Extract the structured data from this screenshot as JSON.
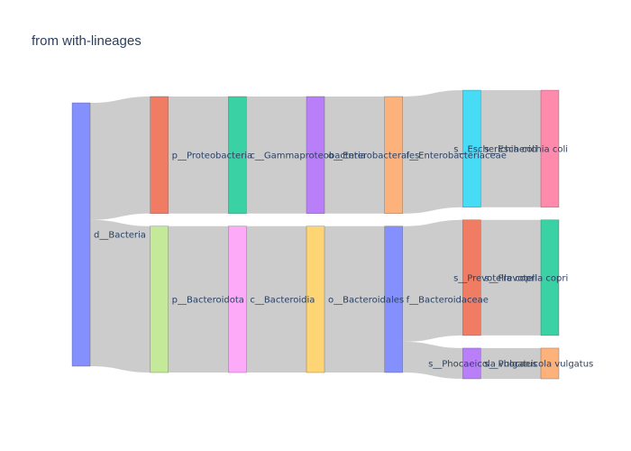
{
  "chart_data": {
    "type": "sankey",
    "title": "from with-lineages",
    "nodes": [
      {
        "id": "d",
        "label": "d__Bacteria",
        "column": 0,
        "color": "#8590ff"
      },
      {
        "id": "p_prot",
        "label": "p__Proteobacteria",
        "column": 1,
        "color": "#f07c63"
      },
      {
        "id": "p_bact",
        "label": "p__Bacteroidota",
        "column": 1,
        "color": "#c4ea99"
      },
      {
        "id": "c_gamma",
        "label": "c__Gammaproteobacteria",
        "column": 2,
        "color": "#3ad1a4"
      },
      {
        "id": "c_bact",
        "label": "c__Bacteroidia",
        "column": 2,
        "color": "#fdaaf8"
      },
      {
        "id": "o_entero",
        "label": "o__Enterobacterales",
        "column": 3,
        "color": "#b97ff9"
      },
      {
        "id": "o_bact",
        "label": "o__Bacteroidales",
        "column": 3,
        "color": "#fed574"
      },
      {
        "id": "f_entero",
        "label": "f__Enterobacteriaceae",
        "column": 4,
        "color": "#fdb27c"
      },
      {
        "id": "f_bact",
        "label": "f__Bacteroidaceae",
        "column": 4,
        "color": "#8590ff"
      },
      {
        "id": "s_ecoli",
        "label": "s__Escherichia coli",
        "column": 5,
        "color": "#48dbf5"
      },
      {
        "id": "s_prev",
        "label": "s__Prevotella copri",
        "column": 5,
        "color": "#f07c63"
      },
      {
        "id": "s_phoc",
        "label": "s__Phocaeicola vulgatus",
        "column": 5,
        "color": "#b97ff9"
      },
      {
        "id": "t_ecoli",
        "label": "s__Escherichia coli",
        "column": 6,
        "color": "#fe8aac"
      },
      {
        "id": "t_prev",
        "label": "s__Prevotella copri",
        "column": 6,
        "color": "#3ad1a4"
      },
      {
        "id": "t_phoc",
        "label": "s__Phocaeicola vulgatus",
        "column": 6,
        "color": "#fdb27c"
      }
    ],
    "links": [
      {
        "source": "d",
        "target": "p_prot",
        "value": 40
      },
      {
        "source": "d",
        "target": "p_bact",
        "value": 50
      },
      {
        "source": "p_prot",
        "target": "c_gamma",
        "value": 40
      },
      {
        "source": "p_bact",
        "target": "c_bact",
        "value": 50
      },
      {
        "source": "c_gamma",
        "target": "o_entero",
        "value": 40
      },
      {
        "source": "c_bact",
        "target": "o_bact",
        "value": 50
      },
      {
        "source": "o_entero",
        "target": "f_entero",
        "value": 40
      },
      {
        "source": "o_bact",
        "target": "f_bact",
        "value": 50
      },
      {
        "source": "f_entero",
        "target": "s_ecoli",
        "value": 40
      },
      {
        "source": "f_bact",
        "target": "s_prev",
        "value": 39.5
      },
      {
        "source": "f_bact",
        "target": "s_phoc",
        "value": 10.5
      },
      {
        "source": "s_ecoli",
        "target": "t_ecoli",
        "value": 40
      },
      {
        "source": "s_prev",
        "target": "t_prev",
        "value": 39.5
      },
      {
        "source": "s_phoc",
        "target": "t_phoc",
        "value": 10.5
      }
    ]
  }
}
